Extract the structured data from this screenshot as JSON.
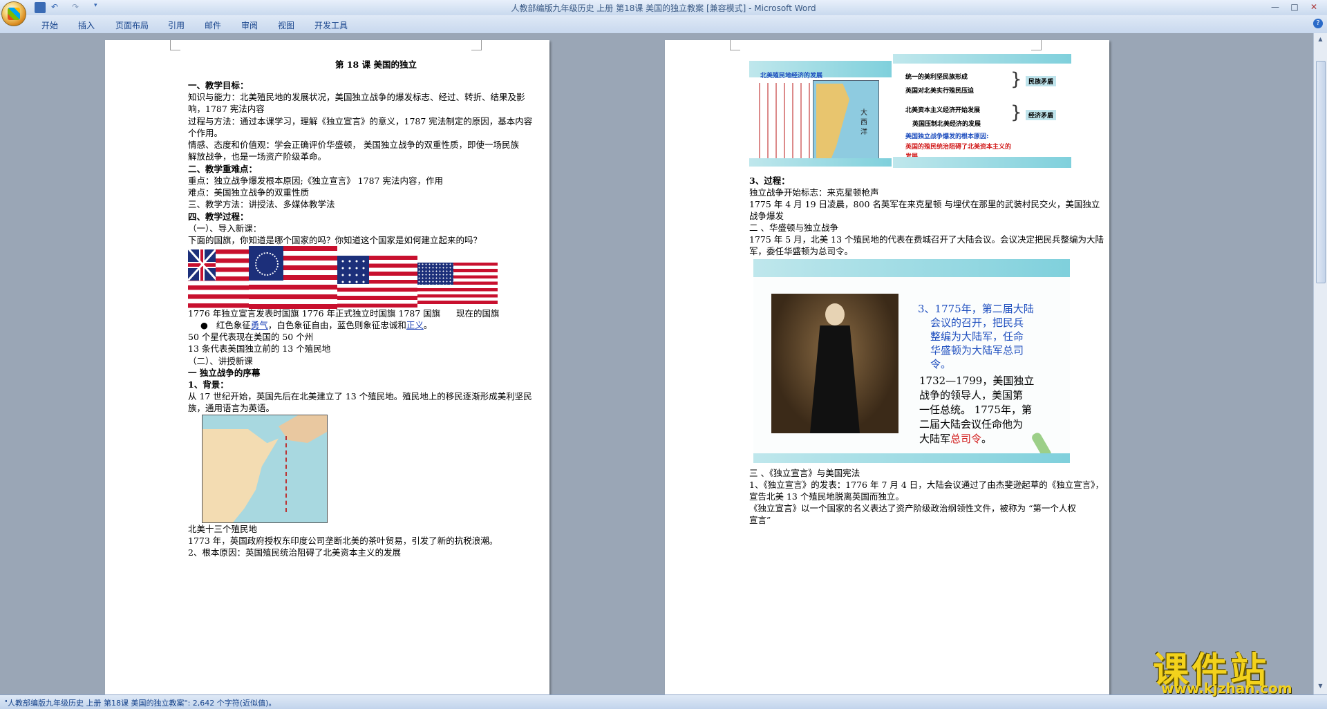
{
  "window": {
    "title": "人教部编版九年级历史 上册 第18课  美国的独立教案 [兼容模式] - Microsoft Word",
    "controls": [
      "—",
      "□",
      "✕"
    ]
  },
  "ribbon": {
    "tabs": [
      "开始",
      "插入",
      "页面布局",
      "引用",
      "邮件",
      "审阅",
      "视图",
      "开发工具"
    ],
    "help": "?"
  },
  "page1": {
    "title": "第 18 课   美国的独立",
    "lines": [
      "一、教学目标：",
      "知识与能力：北美殖民地的发展状况，美国独立战争的爆发标志、经过、转折、结果及影",
      "响，1787 宪法内容",
      "过程与方法：通过本课学习，理解《独立宣言》的意义，1787 宪法制定的原因，基本内容",
      "个作用。",
      "  情感、态度和价值观：学会正确评价华盛顿，  美国独立战争的双重性质，即使一场民族",
      "解放战争，也是一场资产阶级革命。",
      " 二、教学重难点：",
      "重点：独立战争爆发根本原因;《独立宣言》 1787 宪法内容，作用",
      "难点：美国独立战争的双重性质",
      "三、教学方法：讲授法、多媒体教学法",
      "四、教学过程：",
      " （一）、导入新课：",
      "下面的国旗，你知道是哪个国家的吗？你知道这个国家是如何建立起来的吗？"
    ],
    "flag_caption_left": "1776 年独立宣言发表时国旗 1776 年正式独立时国旗 1787 国旗",
    "flag_caption_right": "现在的国旗",
    "bullet_prefix": "红色象征",
    "bullet_link1": "勇气",
    "bullet_mid": "，白色象征自由，蓝色则象征忠诚和",
    "bullet_link2": "正义",
    "bullet_suffix": "。",
    "lines2": [
      "50 个星代表现在美国的 50 个州",
      "13 条代表美国独立前的 13 个殖民地",
      " （二）、讲授新课",
      "一 独立战争的序幕",
      "1、背景：",
      "从 17 世纪开始，英国先后在北美建立了 13 个殖民地。殖民地上的移民逐渐形成美利坚民",
      "族，通用语言为英语。"
    ],
    "map_caption": "北美十三个殖民地",
    "lines3": [
      "1773 年，英国政府授权东印度公司垄断北美的茶叶贸易，引发了新的抗税浪潮。",
      "2、根本原因：英国殖民统治阻碍了北美资本主义的发展"
    ]
  },
  "page2": {
    "slide1_map_title": "北美殖民地经济的发展",
    "slide1_map_label": "大西洋",
    "slide1_rows": [
      "统一的美利坚民族形成",
      "英国对北美实行殖民压迫",
      "北美资本主义经济开始发展",
      "英国压制北美经济的发展"
    ],
    "slide1_tag1": "民族矛盾",
    "slide1_tag2": "经济矛盾",
    "slide1_q": "美国独立战争爆发的根本原因:",
    "slide1_a1": "英国的殖民统治阻碍了北美资本主义的",
    "slide1_a2": "发展。",
    "lines_a": [
      "3、过程：",
      " 独立战争开始标志：来克星顿枪声",
      "1775 年 4 月 19 日凌晨，800 名英军在来克星顿  与埋伏在那里的武装村民交火，美国独立",
      "战争爆发",
      "  二 、华盛顿与独立战争",
      "1775 年 5 月，北美 13 个殖民地的代表在费城召开了大陆会议。会议决定把民兵整编为大陆",
      "军，委任华盛顿为总司令。"
    ],
    "slide2_top": [
      "3、1775年，第二届大陆",
      "会议的召开，把民兵",
      "整编为大陆军，任命",
      "华盛顿为大陆军总司",
      "令。"
    ],
    "slide2_bottom": [
      "1732—1799，美国独立",
      "战争的领导人，美国第",
      "一任总统。 1775年，第",
      "二届大陆会议任命他为"
    ],
    "slide2_last_prefix": "大陆军",
    "slide2_last_red": "总司令",
    "slide2_last_suffix": "。",
    "lines_b": [
      " 三 、《独立宣言》与美国宪法",
      "1、《独立宣言》的发表：1776 年 7 月 4 日，大陆会议通过了由杰斐逊起草的《独立宣言》，",
      "宣告北美 13 个殖民地脱离英国而独立。",
      "  《独立宣言》以一个国家的名义表达了资产阶级政治纲领性文件，被称为 “第一个人权",
      "宣言”"
    ]
  },
  "status": {
    "text": "\"人教部编版九年级历史 上册 第18课  美国的独立教案\": 2,642 个字符(近似值)。"
  },
  "watermark": {
    "title": "课件站",
    "url": "www.kjzhan.com"
  },
  "colors": {
    "ribbon_text": "#15428b",
    "link": "#1a3fb5",
    "slide_blue": "#1f4fbf",
    "slide_red": "#d21d1d",
    "flag_red": "#c8102e",
    "flag_blue": "#1c2f7a"
  }
}
